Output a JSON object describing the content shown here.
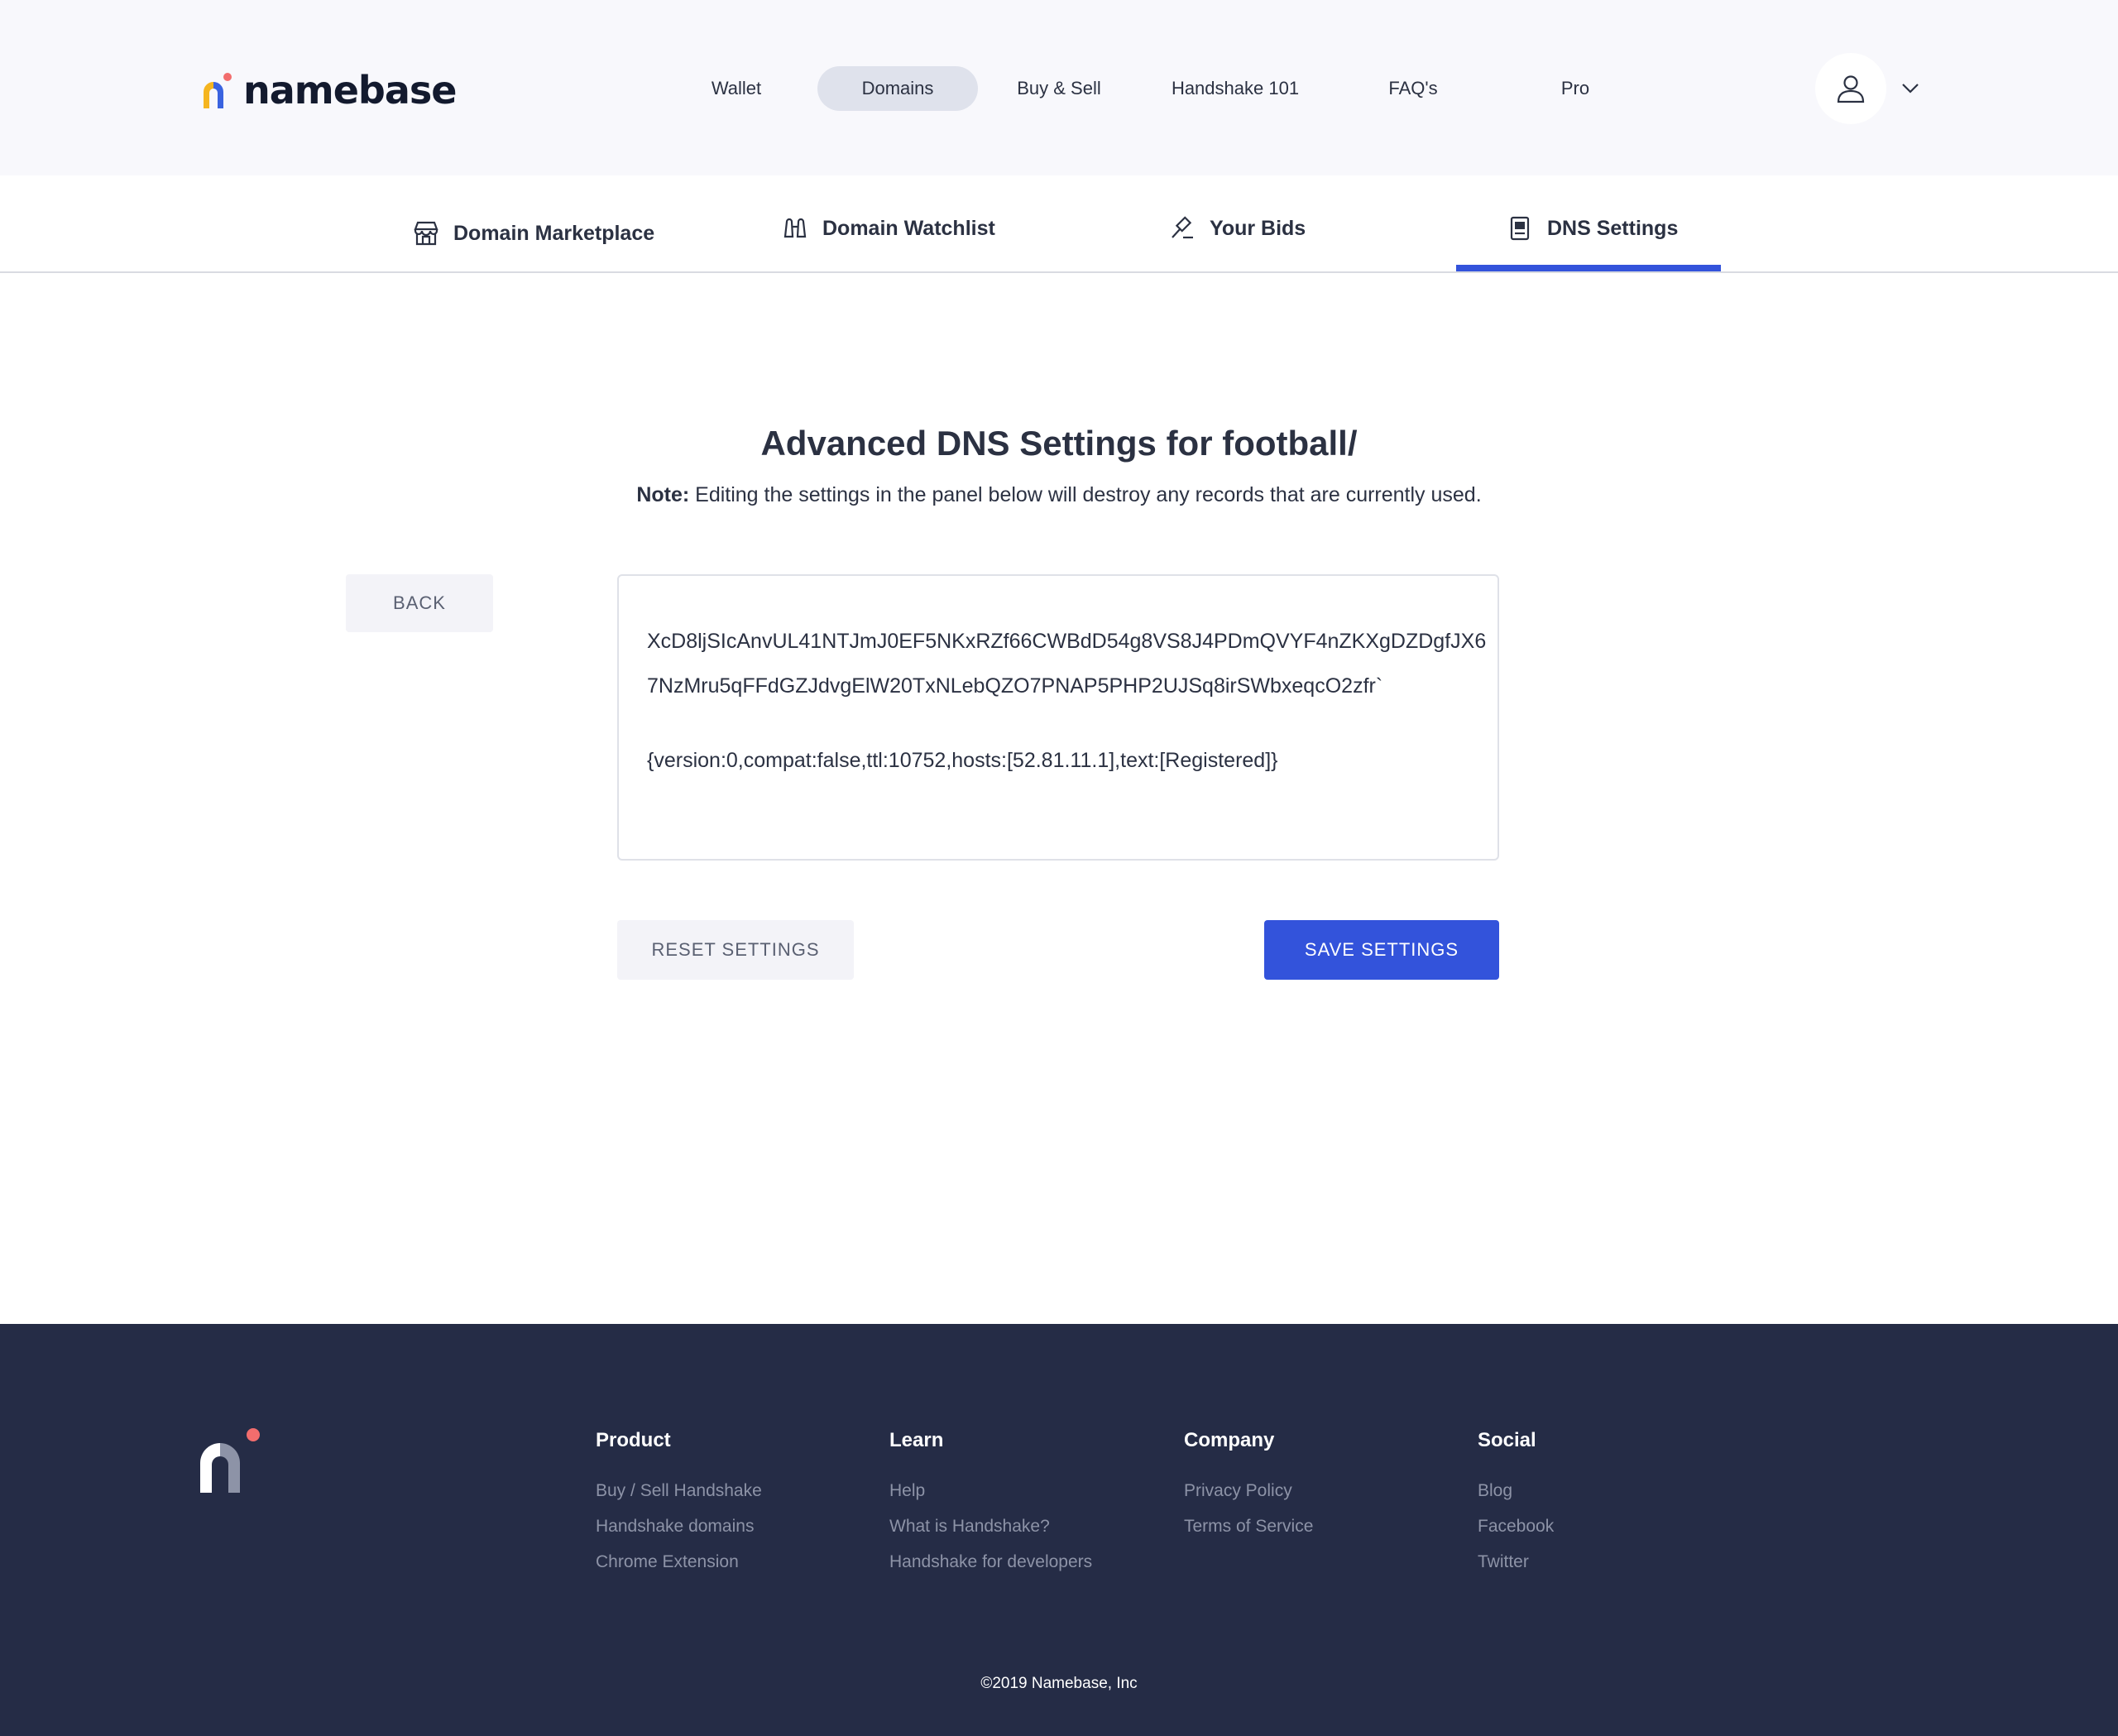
{
  "brand": {
    "name": "namebase"
  },
  "nav": {
    "items": [
      {
        "label": "Wallet"
      },
      {
        "label": "Domains"
      },
      {
        "label": "Buy & Sell"
      },
      {
        "label": "Handshake 101"
      },
      {
        "label": "FAQ's"
      },
      {
        "label": "Pro"
      }
    ],
    "active": "Domains",
    "avatar_icon": "user-icon",
    "caret_icon": "chevron-down-icon"
  },
  "subtabs": {
    "items": [
      {
        "label": "Domain Marketplace",
        "icon": "storefront-icon"
      },
      {
        "label": "Domain Watchlist",
        "icon": "binoculars-icon"
      },
      {
        "label": "Your Bids",
        "icon": "gavel-icon"
      },
      {
        "label": "DNS Settings",
        "icon": "document-icon"
      }
    ],
    "active": "DNS Settings"
  },
  "main": {
    "title": "Advanced DNS Settings for football/",
    "note_label": "Note:",
    "note_text": " Editing the settings in the panel below will destroy any records that are currently used.",
    "back_label": "BACK",
    "editor_lines": [
      "XcD8ljSIcAnvUL41NTJmJ0EF5NKxRZf66CWBdD54g8VS8J4PDmQVYF4nZKXgDZDgfJX6",
      "7NzMru5qFFdGZJdvgElW20TxNLebQZO7PNAP5PHP2UJSq8irSWbxeqcO2zfr`",
      "{version:0,compat:false,ttl:10752,hosts:[52.81.11.1],text:[Registered]}"
    ],
    "reset_label": "RESET SETTINGS",
    "save_label": "SAVE SETTINGS"
  },
  "footer": {
    "columns": [
      {
        "heading": "Product",
        "links": [
          "Buy / Sell Handshake",
          "Handshake domains",
          "Chrome Extension"
        ]
      },
      {
        "heading": "Learn",
        "links": [
          "Help",
          "What is Handshake?",
          "Handshake for developers"
        ]
      },
      {
        "heading": "Company",
        "links": [
          "Privacy Policy",
          "Terms of Service"
        ]
      },
      {
        "heading": "Social",
        "links": [
          "Blog",
          "Facebook",
          "Twitter"
        ]
      }
    ],
    "copyright": "©2019 Namebase, Inc"
  },
  "colors": {
    "accent": "#3353db",
    "footer_bg": "#252c46",
    "nav_bg": "#f8f8fc",
    "logo_yellow": "#f5b51f",
    "logo_blue": "#3a63e0",
    "logo_red": "#f26d6d"
  }
}
